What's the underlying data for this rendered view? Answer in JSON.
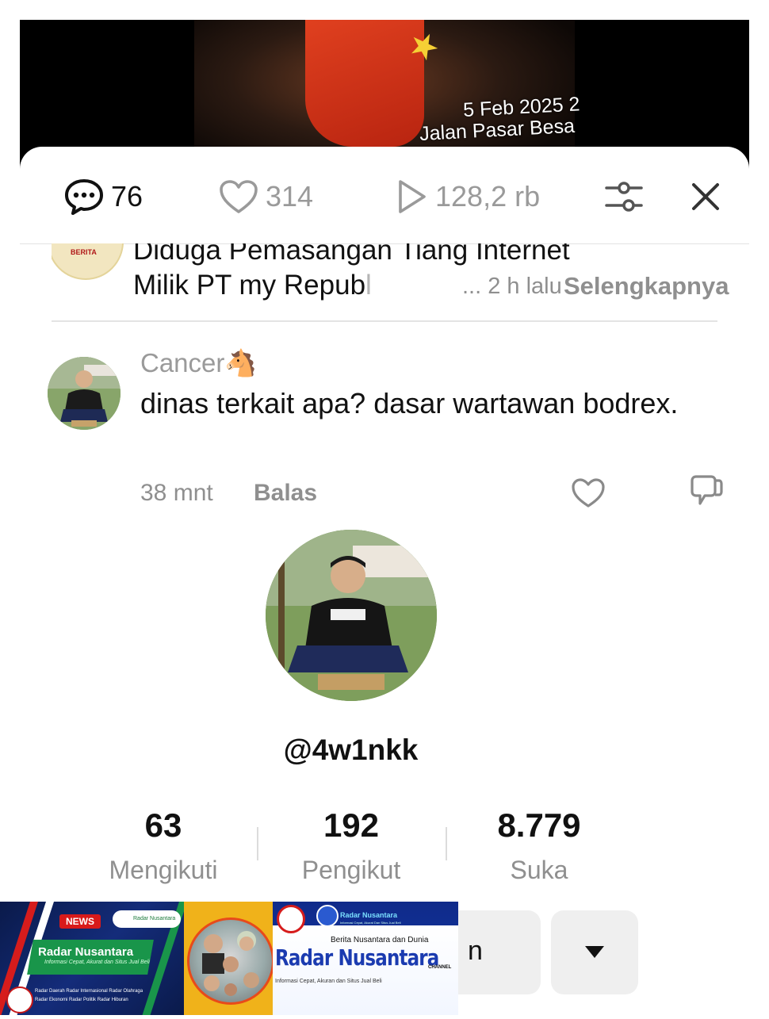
{
  "video": {
    "date_overlay": "5 Feb 2025 2",
    "location_overlay": "Jalan Pasar Besa"
  },
  "topbar": {
    "comments_count": "76",
    "likes_count": "314",
    "plays_count": "128,2 rb",
    "icons": [
      "comment-icon",
      "heart-icon",
      "play-icon",
      "filter-icon",
      "close-icon"
    ]
  },
  "news_item": {
    "line1": "Diduga Pemasangan Tiang Internet",
    "line2_visible": "Milik PT my Repub",
    "line2_faded": "l",
    "ellipsis": "...",
    "time": "2 h lalu",
    "more_label": "Selengkapnya"
  },
  "comment": {
    "username": "Cancer",
    "username_emoji": "🐴",
    "text": "dinas terkait apa? dasar wartawan bodrex.",
    "time": "38 mnt",
    "reply_label": "Balas"
  },
  "profile": {
    "handle": "@4w1nkk",
    "stats": [
      {
        "value": "63",
        "label": "Mengikuti"
      },
      {
        "value": "192",
        "label": "Pengikut"
      },
      {
        "value": "8.779",
        "label": "Suka"
      }
    ],
    "action_partial_label": "n"
  },
  "banner": {
    "news_badge": "NEWS",
    "pill_text": "Radar Nusantara",
    "left_title": "Radar Nusantara",
    "left_subtitle": "Informasi Cepat, Akurat dan Situs Jual Beli",
    "left_links_row1": "Radar Daerah   Radar Internasional   Radar Olahraga",
    "left_links_row2": "Radar Ekonomi   Radar Politik   Radar Hiburan",
    "right_small_title": "Radar Nusantara",
    "right_small_tagline": "Informasi Cepat, Akurat Dan Situs Jual Beli",
    "right_headline": "Berita Nusantara dan Dunia",
    "right_big_title": "Radar Nusantara",
    "right_channel": "CHANNEL",
    "right_tagline": "Informasi Cepat, Akuran dan Situs Jual Beli"
  },
  "colors": {
    "text_primary": "#111111",
    "text_muted": "#8f8f8f",
    "divider": "#e4e4e4",
    "button_bg": "#efefef"
  }
}
